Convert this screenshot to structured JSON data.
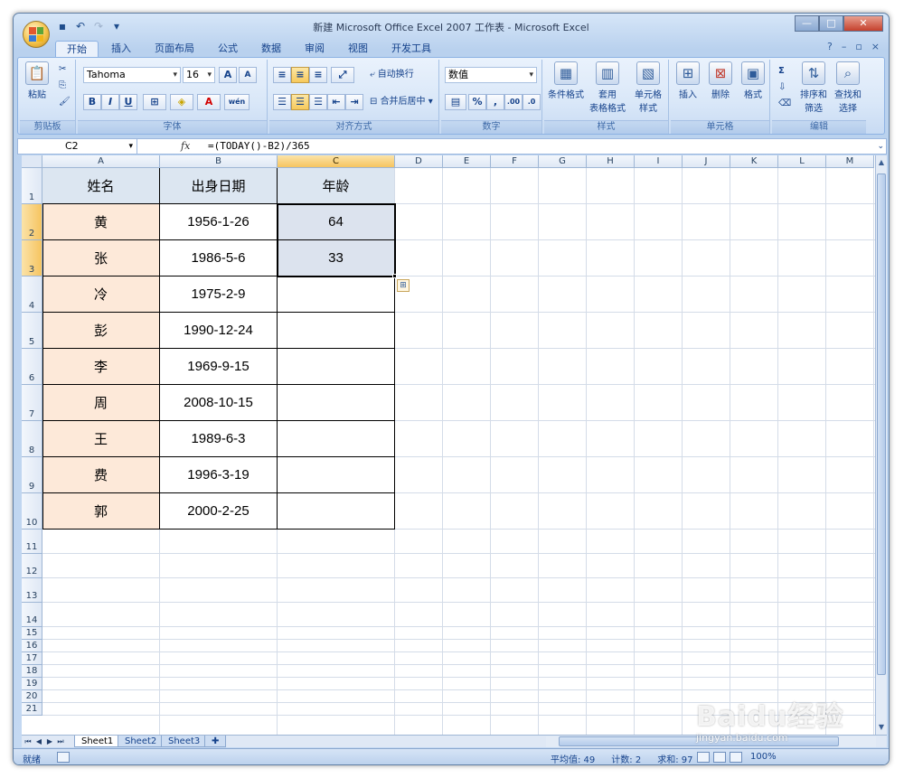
{
  "window": {
    "title": "新建 Microsoft Office Excel 2007 工作表 - Microsoft Excel",
    "controls": {
      "minimize": "—",
      "maximize": "□",
      "close": "✕"
    }
  },
  "ribbon": {
    "tabs": [
      "开始",
      "插入",
      "页面布局",
      "公式",
      "数据",
      "审阅",
      "视图",
      "开发工具"
    ],
    "active_tab": "开始",
    "groups": {
      "clipboard": {
        "label": "剪贴板",
        "paste": "粘贴"
      },
      "font": {
        "label": "字体",
        "font_name": "Tahoma",
        "font_size": "16",
        "grow": "A",
        "shrink": "A",
        "bold": "B",
        "italic": "I",
        "underline": "U",
        "phonetic": "wén"
      },
      "alignment": {
        "label": "对齐方式",
        "wrap_text": "自动换行",
        "merge_center": "合并后居中"
      },
      "number": {
        "label": "数字",
        "format": "数值",
        "percent": "%",
        "comma": ",",
        "inc_decimal": ".00",
        "dec_decimal": ".0"
      },
      "styles": {
        "label": "样式",
        "conditional": "条件格式",
        "table_format_1": "套用",
        "table_format_2": "表格格式",
        "cell_styles_1": "单元格",
        "cell_styles_2": "样式"
      },
      "cells": {
        "label": "单元格",
        "insert": "插入",
        "delete": "删除",
        "format": "格式"
      },
      "editing": {
        "label": "编辑",
        "sort_filter_1": "排序和",
        "sort_filter_2": "筛选",
        "find_select_1": "查找和",
        "find_select_2": "选择",
        "sigma": "Σ"
      }
    }
  },
  "formula_bar": {
    "name_box": "C2",
    "fx": "fx",
    "formula": "=(TODAY()-B2)/365"
  },
  "sheet": {
    "columns": [
      "A",
      "B",
      "C",
      "D",
      "E",
      "F",
      "G",
      "H",
      "I",
      "J",
      "K",
      "L",
      "M"
    ],
    "rows": [
      "1",
      "2",
      "3",
      "4",
      "5",
      "6",
      "7",
      "8",
      "9",
      "10",
      "11",
      "12",
      "13",
      "14",
      "15",
      "16",
      "17",
      "18",
      "19",
      "20",
      "21"
    ],
    "header": [
      "姓名",
      "出身日期",
      "年龄"
    ],
    "data": [
      [
        "黄",
        "1956-1-26",
        "64"
      ],
      [
        "张",
        "1986-5-6",
        "33"
      ],
      [
        "冷",
        "1975-2-9",
        ""
      ],
      [
        "彭",
        "1990-12-24",
        ""
      ],
      [
        "李",
        "1969-9-15",
        ""
      ],
      [
        "周",
        "2008-10-15",
        ""
      ],
      [
        "王",
        "1989-6-3",
        ""
      ],
      [
        "费",
        "1996-3-19",
        ""
      ],
      [
        "郭",
        "2000-2-25",
        ""
      ]
    ]
  },
  "sheet_tabs": [
    "Sheet1",
    "Sheet2",
    "Sheet3"
  ],
  "active_sheet": "Sheet1",
  "status_bar": {
    "ready": "就绪",
    "average": "平均值: 49",
    "count": "计数: 2",
    "sum": "求和: 97",
    "zoom": "100%"
  },
  "watermark": {
    "text": "Baidu经验",
    "sub": "jingyan.baidu.com"
  },
  "colors": {
    "name_fill": "#fde9d9",
    "header_fill": "#dce6f1",
    "selected_fill": "#dce3ee",
    "ribbon_bg": "#d9e7f8"
  }
}
